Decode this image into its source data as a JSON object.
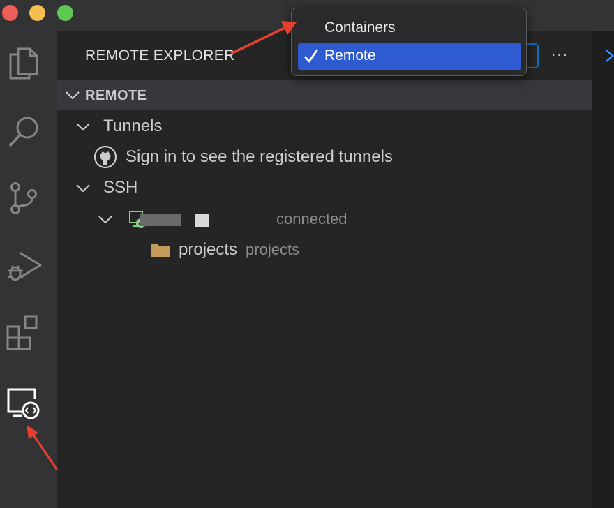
{
  "window": {
    "traffic_lights": [
      "close",
      "minimize",
      "maximize"
    ]
  },
  "activity_bar": {
    "items": [
      "explorer-icon",
      "search-icon",
      "source-control-icon",
      "run-debug-icon",
      "extensions-icon",
      "remote-explorer-icon"
    ],
    "active": "remote-explorer-icon"
  },
  "panel": {
    "title": "REMOTE EXPLORER",
    "more_label": "···"
  },
  "section": {
    "title": "REMOTE"
  },
  "tree": {
    "tunnels": {
      "label": "Tunnels",
      "sign_in": "Sign in to see the registered tunnels"
    },
    "ssh": {
      "label": "SSH",
      "host_status": "connected",
      "folder_label": "projects",
      "folder_desc": "projects"
    }
  },
  "dropdown": {
    "items": [
      {
        "label": "Containers",
        "selected": false
      },
      {
        "label": "Remote",
        "selected": true
      }
    ]
  },
  "colors": {
    "accent": "#2e5bd2",
    "annotation": "#e8402f",
    "folder": "#c69a58",
    "connected": "#89d185"
  }
}
